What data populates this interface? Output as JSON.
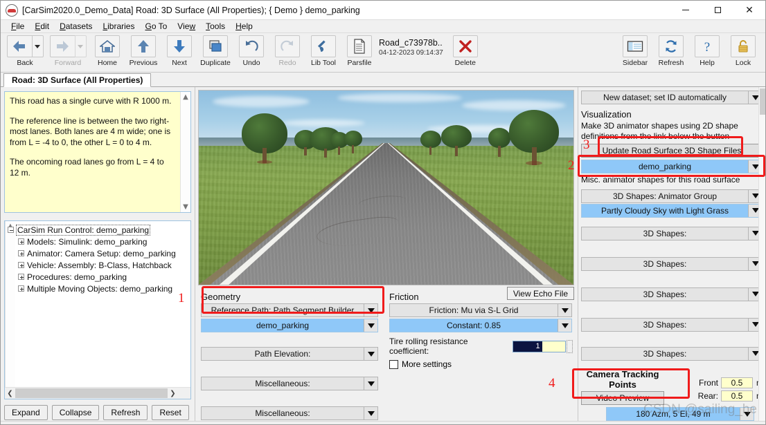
{
  "window": {
    "title": "[CarSim2020.0_Demo_Data] Road: 3D Surface (All Properties); { Demo } demo_parking",
    "app_icon": "carsim-car-icon",
    "minimize": "minimize-icon",
    "maximize": "maximize-icon",
    "close": "close-icon"
  },
  "menubar": {
    "items": [
      {
        "label": "File",
        "accel": "F"
      },
      {
        "label": "Edit",
        "accel": "E"
      },
      {
        "label": "Datasets",
        "accel": "D"
      },
      {
        "label": "Libraries",
        "accel": "L"
      },
      {
        "label": "Go To",
        "accel": "G"
      },
      {
        "label": "View",
        "accel": "w"
      },
      {
        "label": "Tools",
        "accel": "T"
      },
      {
        "label": "Help",
        "accel": "H"
      }
    ]
  },
  "toolbar": {
    "left": [
      {
        "label": "Back",
        "icon": "arrow-left-icon",
        "enabled": true,
        "has_dropdown": true
      },
      {
        "label": "Forward",
        "icon": "arrow-right-icon",
        "enabled": false,
        "has_dropdown": true
      },
      {
        "label": "Home",
        "icon": "home-icon",
        "enabled": true
      },
      {
        "label": "Previous",
        "icon": "arrow-up-icon",
        "enabled": true
      },
      {
        "label": "Next",
        "icon": "arrow-down-icon",
        "enabled": true
      },
      {
        "label": "Duplicate",
        "icon": "duplicate-windows-icon",
        "enabled": true
      },
      {
        "label": "Undo",
        "icon": "undo-arrow-icon",
        "enabled": true
      },
      {
        "label": "Redo",
        "icon": "redo-arrow-icon",
        "enabled": false
      },
      {
        "label": "Lib Tool",
        "icon": "wrench-icon",
        "enabled": true
      },
      {
        "label": "Parsfile",
        "icon": "document-lines-icon",
        "enabled": true
      }
    ],
    "parsfile": {
      "name": "Road_c73978b..",
      "timestamp": "04-12-2023 09:14:37"
    },
    "delete": {
      "label": "Delete",
      "icon": "red-x-icon"
    },
    "right": [
      {
        "label": "Sidebar",
        "icon": "sidebar-panel-icon"
      },
      {
        "label": "Refresh",
        "icon": "refresh-circular-arrows-icon"
      },
      {
        "label": "Help",
        "icon": "question-mark-icon"
      },
      {
        "label": "Lock",
        "icon": "padlock-icon"
      }
    ]
  },
  "tab": {
    "label": "Road: 3D Surface (All Properties)"
  },
  "notes": {
    "paragraphs": [
      "This road has a single curve with R  1000 m.",
      "The reference line is between the two right-most lanes. Both lanes are 4 m wide; one is from L = -4 to 0, the other L = 0 to 4 m.",
      "The oncoming road lanes go from L = 4 to 12 m."
    ],
    "scroll_up": "scroll-up-chevron-icon",
    "scroll_down": "scroll-down-chevron-icon"
  },
  "tree": {
    "root": {
      "label": "CarSim Run Control: demo_parking",
      "expanded": true
    },
    "children": [
      {
        "label": "Models: Simulink: demo_parking"
      },
      {
        "label": "Animator: Camera Setup: demo_parking"
      },
      {
        "label": "Vehicle: Assembly: B-Class, Hatchback"
      },
      {
        "label": "Procedures: demo_parking"
      },
      {
        "label": "Multiple Moving Objects: demo_parking"
      }
    ]
  },
  "left_buttons": [
    {
      "label": "Expand"
    },
    {
      "label": "Collapse"
    },
    {
      "label": "Refresh"
    },
    {
      "label": "Reset"
    }
  ],
  "viewport": {
    "description": "3D animator preview of a straight two-lane asphalt road with grass, trees and partly cloudy sky"
  },
  "geometry": {
    "section_label": "Geometry",
    "reference_path": {
      "label": "Reference Path: Path Segment Builder",
      "arrow": "chevron-down-icon"
    },
    "reference_path_value": {
      "label": "demo_parking",
      "arrow": "chevron-down-icon"
    },
    "path_elevation": {
      "label": "Path Elevation:",
      "arrow": "chevron-down-icon"
    },
    "misc_1": {
      "label": "Miscellaneous:",
      "arrow": "chevron-down-icon"
    },
    "misc_2": {
      "label": "Miscellaneous:",
      "arrow": "chevron-down-icon"
    }
  },
  "friction": {
    "section_label": "Friction",
    "echo_button": "View Echo File",
    "type": {
      "label": "Friction: Mu via S-L Grid",
      "arrow": "chevron-down-icon"
    },
    "value": {
      "label": "Constant: 0.85",
      "arrow": "chevron-down-icon"
    },
    "rolling_resistance": {
      "label": "Tire rolling resistance coefficient:",
      "value": "1"
    },
    "more_settings": {
      "label": "More settings",
      "checked": false
    }
  },
  "right_panel": {
    "dataset_combo": {
      "label": "New dataset; set ID automatically",
      "arrow": "chevron-down-icon"
    },
    "visualization_label": "Visualization",
    "visualization_help": "Make 3D animator shapes using 2D shape definitions from the link below the button",
    "update_button": {
      "label": "Update Road Surface 3D Shape Files",
      "accel": "U"
    },
    "road_surface_value": {
      "label": "demo_parking",
      "arrow": "chevron-down-icon"
    },
    "misc_shapes_label": "Misc. animator shapes for this road surface",
    "shape_combos": [
      {
        "label": "3D Shapes: Animator Group",
        "selected": false
      },
      {
        "label": "Partly Cloudy Sky with Light Grass",
        "selected": true
      },
      {
        "label": "3D Shapes:",
        "selected": false
      },
      {
        "label": "3D Shapes:",
        "selected": false
      },
      {
        "label": "3D Shapes:",
        "selected": false
      },
      {
        "label": "3D Shapes:",
        "selected": false
      },
      {
        "label": "3D Shapes:",
        "selected": false
      }
    ]
  },
  "camera": {
    "title": "Camera Tracking Points",
    "preview_button": {
      "label": "Video Preview",
      "accel": "V"
    },
    "front": {
      "label": "Front",
      "value": "0.5",
      "unit": "m"
    },
    "rear": {
      "label": "Rear:",
      "value": "0.5",
      "unit": "m"
    },
    "view_combo": {
      "label": "180 Azm, 5 El, 49 m",
      "arrow": "chevron-down-icon"
    }
  },
  "annotations": {
    "markers": [
      {
        "id": "1",
        "target": "geometry-reference-path-group"
      },
      {
        "id": "2",
        "target": "road-surface-shape-value"
      },
      {
        "id": "3",
        "target": "update-road-surface-3d-shape-files-button"
      },
      {
        "id": "4",
        "target": "camera-tracking-points-group"
      }
    ],
    "accent_color": "#f01b1b"
  },
  "watermark": {
    "text": "CSDN @sailing_he"
  }
}
